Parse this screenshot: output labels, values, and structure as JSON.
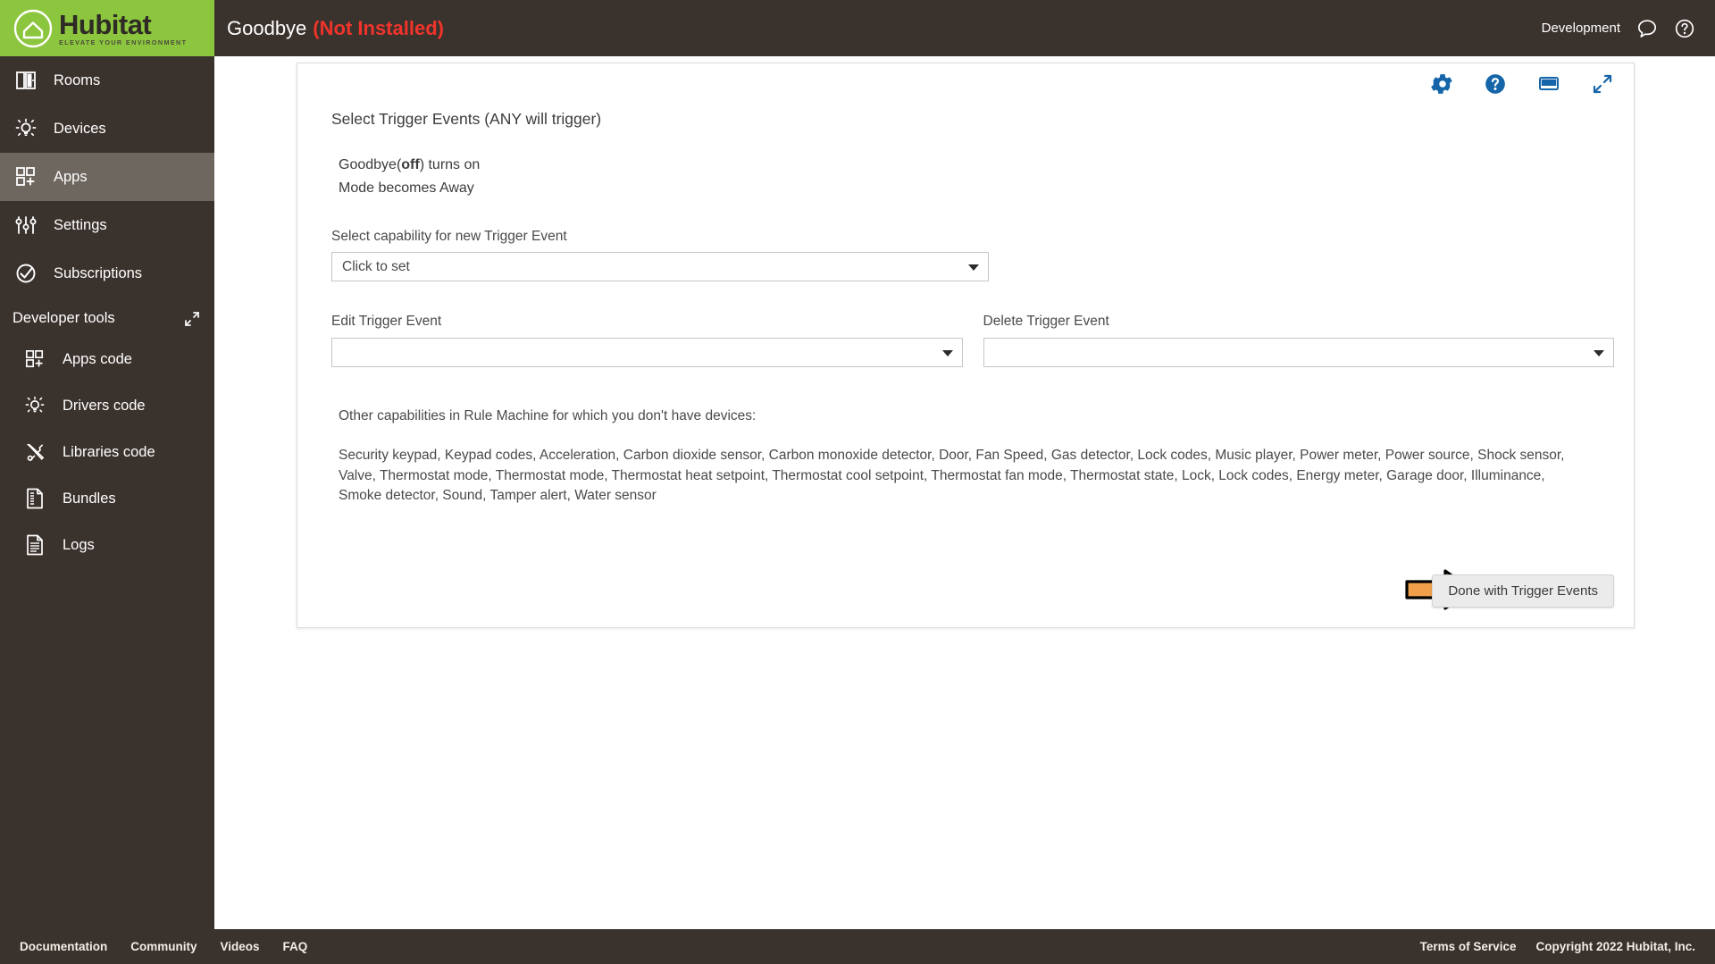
{
  "brand": {
    "name": "Hubitat",
    "tagline": "ELEVATE YOUR ENVIRONMENT",
    "green": "#8cc63e",
    "dark": "#3a322d"
  },
  "header": {
    "title": "Goodbye",
    "status": "(Not Installed)",
    "status_color": "#f0342b",
    "environment": "Development",
    "icons": [
      "chat-bubble-icon",
      "help-circle-icon"
    ]
  },
  "sidebar": {
    "items": [
      {
        "label": "Rooms",
        "icon": "rooms-icon",
        "active": false
      },
      {
        "label": "Devices",
        "icon": "devices-bulb-icon",
        "active": false
      },
      {
        "label": "Apps",
        "icon": "apps-grid-icon",
        "active": true
      },
      {
        "label": "Settings",
        "icon": "settings-sliders-icon",
        "active": false
      },
      {
        "label": "Subscriptions",
        "icon": "subscriptions-check-icon",
        "active": false
      }
    ],
    "devtools": {
      "label": "Developer tools",
      "collapse_icon": "collapse-arrows-icon",
      "items": [
        {
          "label": "Apps code",
          "icon": "apps-code-grid-icon"
        },
        {
          "label": "Drivers code",
          "icon": "drivers-code-bulb-icon"
        },
        {
          "label": "Libraries code",
          "icon": "libraries-code-tools-icon"
        },
        {
          "label": "Bundles",
          "icon": "bundles-zip-icon"
        },
        {
          "label": "Logs",
          "icon": "logs-document-icon"
        }
      ]
    }
  },
  "card": {
    "tools": [
      {
        "name": "gear-icon",
        "title": "Settings"
      },
      {
        "name": "help-circle-icon",
        "title": "Help"
      },
      {
        "name": "display-icon",
        "title": "Display"
      },
      {
        "name": "expand-icon",
        "title": "Expand"
      }
    ],
    "accent_color": "#1565a8",
    "section_title": "Select Trigger Events (ANY will trigger)",
    "triggers": [
      {
        "prefix": "Goodbye(",
        "bold": "off",
        "suffix": ") turns on"
      },
      {
        "prefix": "Mode becomes Away",
        "bold": "",
        "suffix": ""
      }
    ],
    "capability_select": {
      "label": "Select capability for new Trigger Event",
      "value": "Click to set"
    },
    "edit_select": {
      "label": "Edit Trigger Event",
      "value": ""
    },
    "delete_select": {
      "label": "Delete Trigger Event",
      "value": ""
    },
    "other_caps_heading": "Other capabilities in Rule Machine for which you don't have devices:",
    "other_caps_list": "Security keypad, Keypad codes, Acceleration, Carbon dioxide sensor, Carbon monoxide detector, Door, Fan Speed, Gas detector, Lock codes, Music player, Power meter, Power source, Shock sensor, Valve, Thermostat mode, Thermostat mode, Thermostat heat setpoint, Thermostat cool setpoint, Thermostat fan mode, Thermostat state, Lock, Lock codes, Energy meter, Garage door, Illuminance, Smoke detector, Sound, Tamper alert, Water sensor",
    "done_button": "Done with Trigger Events",
    "annotation_arrow": {
      "name": "orange-pointer-arrow",
      "fill": "#f0a04b",
      "stroke": "#000000"
    }
  },
  "footer": {
    "links": [
      "Documentation",
      "Community",
      "Videos",
      "FAQ"
    ],
    "terms": "Terms of Service",
    "copyright": "Copyright 2022 Hubitat, Inc."
  }
}
